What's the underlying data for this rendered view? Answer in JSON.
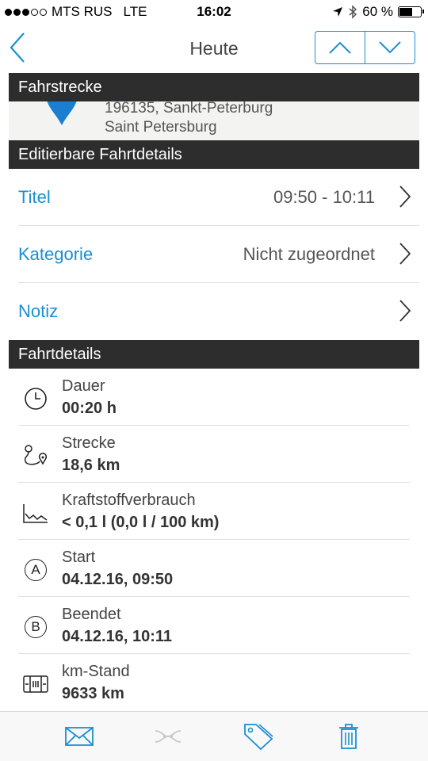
{
  "status_bar": {
    "carrier": "MTS RUS",
    "network": "LTE",
    "time": "16:02",
    "battery_text": "60 %",
    "battery_level": 0.6
  },
  "nav": {
    "title": "Heute",
    "back_icon": "chevron-left-icon",
    "up_icon": "chevron-up-icon",
    "down_icon": "chevron-down-icon"
  },
  "route": {
    "header": "Fahrstrecke",
    "address_line1": "196135, Sankt-Peterburg",
    "address_line2": "Saint Petersburg"
  },
  "editable": {
    "header": "Editierbare Fahrtdetails",
    "rows": [
      {
        "label": "Titel",
        "value": "09:50 - 10:11"
      },
      {
        "label": "Kategorie",
        "value": "Nicht zugeordnet"
      },
      {
        "label": "Notiz",
        "value": ""
      }
    ]
  },
  "details": {
    "header": "Fahrtdetails",
    "rows": [
      {
        "icon": "clock-icon",
        "label": "Dauer",
        "value": "00:20 h"
      },
      {
        "icon": "route-icon",
        "label": "Strecke",
        "value": "18,6 km"
      },
      {
        "icon": "fuel-chart-icon",
        "label": "Kraftstoffverbrauch",
        "value": "< 0,1 l (0,0 l / 100 km)"
      },
      {
        "icon": "start-a-icon",
        "letter": "A",
        "label": "Start",
        "value": "04.12.16, 09:50"
      },
      {
        "icon": "end-b-icon",
        "letter": "B",
        "label": "Beendet",
        "value": "04.12.16, 10:11"
      },
      {
        "icon": "odometer-icon",
        "label": "km-Stand",
        "value": "9633 km"
      }
    ]
  },
  "tab_bar": {
    "icons": [
      "mail-icon",
      "merge-icon",
      "tag-icon",
      "trash-icon"
    ]
  },
  "colors": {
    "accent": "#1a8fd1",
    "header_bg": "#2d2d2d",
    "disabled": "#c8c8c8"
  }
}
